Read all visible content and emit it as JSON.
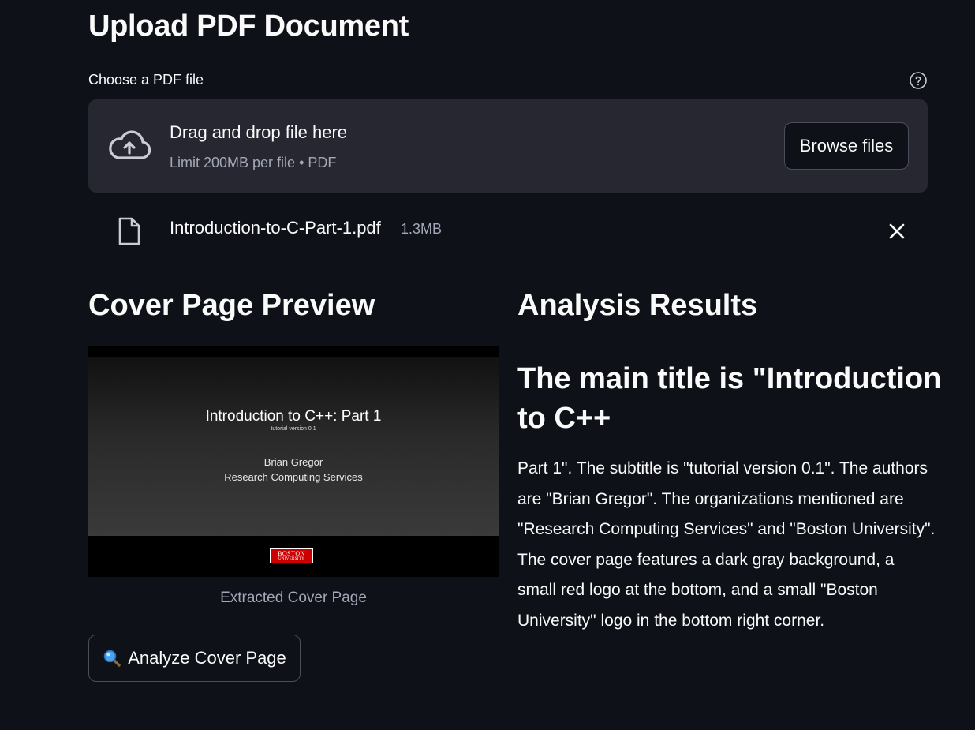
{
  "upload": {
    "title": "Upload PDF Document",
    "label": "Choose a PDF file",
    "drop_text": "Drag and drop file here",
    "limit_text": "Limit 200MB per file • PDF",
    "browse_label": "Browse files"
  },
  "file": {
    "name": "Introduction-to-C-Part-1.pdf",
    "size": "1.3MB"
  },
  "preview": {
    "title": "Cover Page Preview",
    "slide_title": "Introduction to C++: Part 1",
    "slide_subtitle": "tutorial version 0.1",
    "slide_author": "Brian Gregor",
    "slide_org": "Research Computing Services",
    "logo_line1": "BOSTON",
    "logo_line2": "UNIVERSITY",
    "caption": "Extracted Cover Page",
    "analyze_label": "Analyze Cover Page"
  },
  "results": {
    "title": "Analysis Results",
    "heading": "The main title is \"Introduction to C++",
    "body": "Part 1\". The subtitle is \"tutorial version 0.1\". The authors are \"Brian Gregor\". The organizations mentioned are \"Research Computing Services\" and \"Boston University\". The cover page features a dark gray background, a small red logo at the bottom, and a small \"Boston University\" logo in the bottom right corner."
  },
  "icons": {
    "help": "help-circle-icon",
    "upload": "cloud-upload-icon",
    "file": "file-icon",
    "close": "close-icon",
    "analyze": "magnifying-glass-icon"
  },
  "colors": {
    "background": "#0e1117",
    "dropzone": "#262730",
    "muted_text": "#a3a8b8",
    "logo_red": "#cc0000"
  }
}
